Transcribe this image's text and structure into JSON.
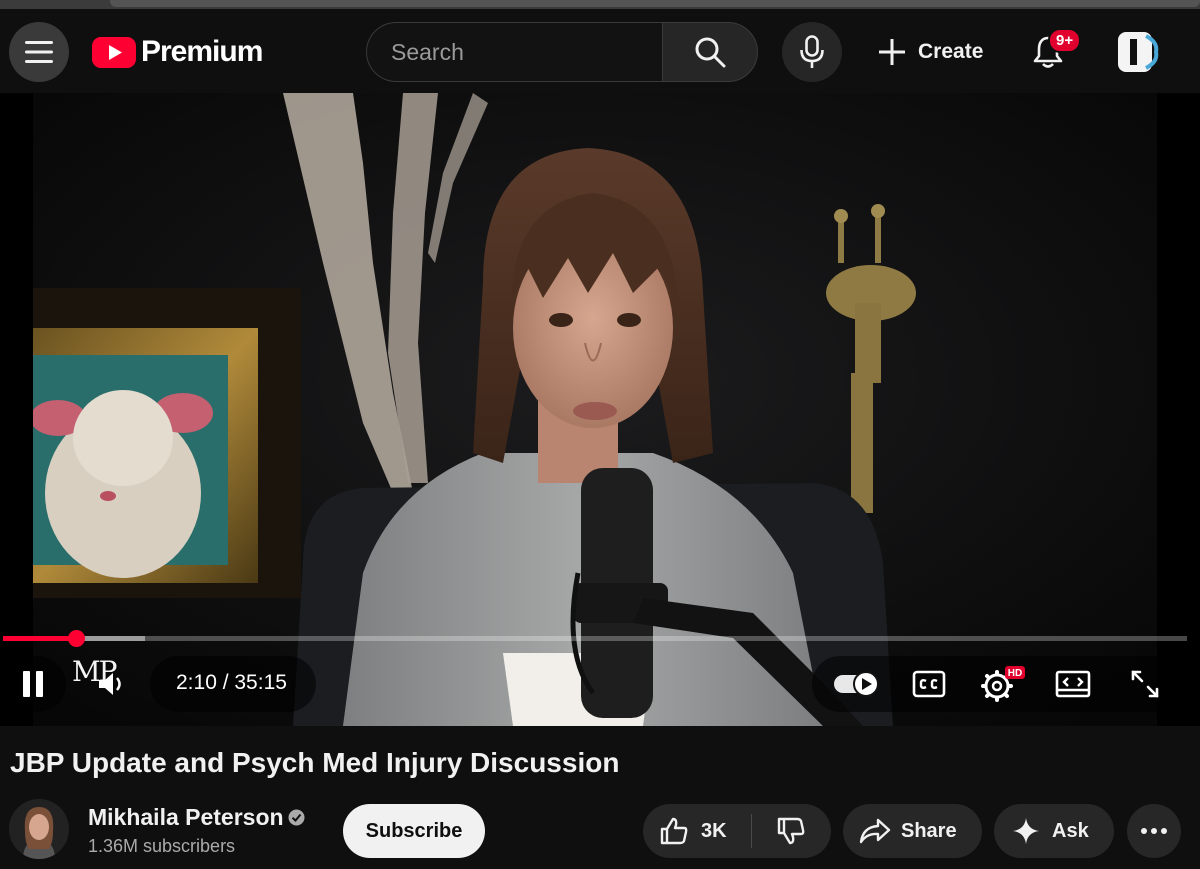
{
  "header": {
    "logo_text": "Premium",
    "search_placeholder": "Search",
    "create_label": "Create",
    "notification_badge": "9+"
  },
  "player": {
    "current_time": "2:10",
    "duration": "35:15",
    "time_display": "2:10 / 35:15",
    "progress_fraction": 0.062,
    "buffered_fraction": 0.12,
    "overlay_logo": "MP",
    "quality_badge": "HD",
    "accent_color": "#ff0033"
  },
  "video": {
    "title": "JBP Update and Psych Med Injury Discussion",
    "channel_name": "Mikhaila Peterson",
    "subscribers": "1.36M subscribers",
    "subscribe_label": "Subscribe",
    "like_count": "3K",
    "share_label": "Share",
    "ask_label": "Ask"
  },
  "icons": [
    "hamburger-menu-icon",
    "youtube-logo-icon",
    "search-icon",
    "microphone-icon",
    "plus-icon",
    "bell-icon",
    "account-icon",
    "pause-icon",
    "volume-icon",
    "autoplay-toggle-icon",
    "captions-icon",
    "settings-icon",
    "theater-mode-icon",
    "fullscreen-icon",
    "verified-icon",
    "thumbs-up-icon",
    "thumbs-down-icon",
    "share-icon",
    "sparkle-icon",
    "more-icon"
  ]
}
